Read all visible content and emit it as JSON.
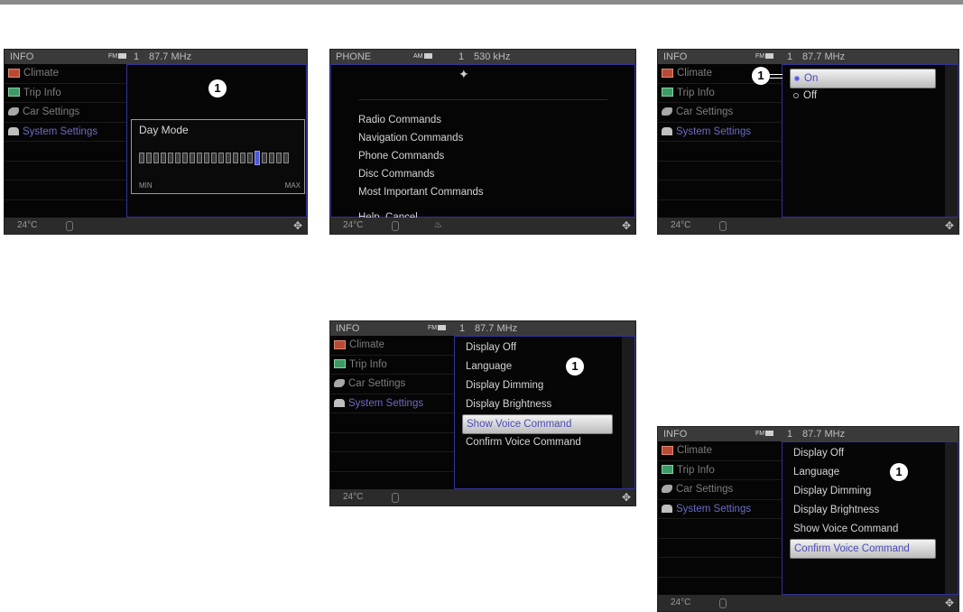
{
  "status_info": {
    "app": "INFO",
    "band": "FM",
    "channel": "1",
    "frequency": "87.7 MHz"
  },
  "status_phone": {
    "app": "PHONE",
    "band": "AM",
    "channel": "1",
    "frequency": "530 kHz"
  },
  "menu": {
    "climate": "Climate",
    "trip_info": "Trip Info",
    "car_settings": "Car Settings",
    "system_settings": "System Settings"
  },
  "bottom": {
    "temperature": "24°C"
  },
  "callout": "1",
  "day_mode": {
    "title": "Day Mode",
    "min": "MIN",
    "max": "MAX",
    "level_segment": 17,
    "segment_count": 21
  },
  "voice": {
    "radio_commands": "Radio Commands",
    "navigation_commands": "Navigation Commands",
    "phone_commands": "Phone Commands",
    "disc_commands": "Disc Commands",
    "most_important_commands": "Most Important Commands",
    "help_cancel": "Help, Cancel"
  },
  "onoff": {
    "on": "On",
    "off": "Off"
  },
  "system_menu": {
    "display_off": "Display Off",
    "language": "Language",
    "display_dimming": "Display Dimming",
    "display_brightness": "Display Brightness",
    "show_voice_command": "Show Voice Command",
    "confirm_voice_command": "Confirm Voice Command"
  }
}
